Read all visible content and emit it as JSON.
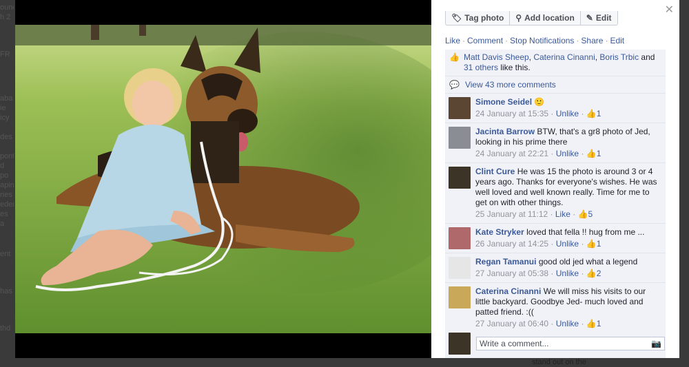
{
  "backdrop": {
    "left_snippets": [
      "ounc",
      "h 2",
      "FR",
      "aba",
      "ie",
      "icy",
      "des",
      "pont",
      "d po",
      "apin",
      "ries",
      "eder",
      "es a",
      "ent",
      "has",
      "thd"
    ],
    "bottom_text": "stand out on the"
  },
  "toolbar": {
    "tag_label": "Tag photo",
    "location_label": "Add location",
    "edit_label": "Edit"
  },
  "actions": [
    "Like",
    "Comment",
    "Stop Notifications",
    "Share",
    "Edit"
  ],
  "likes": {
    "names": [
      "Matt Davis Sheep",
      "Caterina Cinanni",
      "Boris Trbic"
    ],
    "others": "31 others",
    "suffix": "like this."
  },
  "view_more": "View 43 more comments",
  "comments": [
    {
      "name": "Simone Seidel",
      "text": "🙂",
      "time": "24 January at 15:35",
      "unlike": "Unlike",
      "likes": "1",
      "avatar_color": "#5a4632"
    },
    {
      "name": "Jacinta Barrow",
      "text": "BTW, that's a gr8 photo of Jed, looking in his prime there",
      "time": "24 January at 22:21",
      "unlike": "Unlike",
      "likes": "1",
      "avatar_color": "#8a8d93"
    },
    {
      "name": "Clint Cure",
      "text": "He was 15 the photo is around 3 or 4 years ago. Thanks for everyone's wishes. He was well loved and well known really. Time for me to get on with other things.",
      "time": "25 January at 11:12",
      "unlike": "Like",
      "likes": "5",
      "avatar_color": "#3d3428"
    },
    {
      "name": "Kate Stryker",
      "text": "loved that fella !! hug from me ...",
      "time": "26 January at 14:25",
      "unlike": "Unlike",
      "likes": "1",
      "avatar_color": "#b0696a"
    },
    {
      "name": "Regan Tamanui",
      "text": "good old jed what a legend",
      "time": "27 January at 05:38",
      "unlike": "Unlike",
      "likes": "2",
      "avatar_color": "#e6e6e6"
    },
    {
      "name": "Caterina Cinanni",
      "text": "We will miss his visits to our little backyard. Goodbye Jed- much loved and patted friend. :((",
      "time": "27 January at 06:40",
      "unlike": "Unlike",
      "likes": "1",
      "avatar_color": "#c9a85a"
    }
  ],
  "reply": {
    "placeholder": "Write a comment..."
  },
  "colors": {
    "link": "#3b5998",
    "panel": "#ffffff",
    "feed": "#f0f2f7"
  }
}
